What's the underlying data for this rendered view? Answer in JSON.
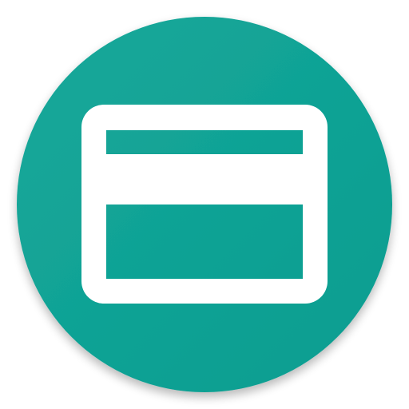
{
  "app_icon": {
    "icon": "credit-card-icon",
    "colors": {
      "background": "#ffffff",
      "circle": "#16a89a",
      "circle_gradient_end": "#0b9d90",
      "shadow": "#000000",
      "glyph": "#ffffff"
    }
  }
}
